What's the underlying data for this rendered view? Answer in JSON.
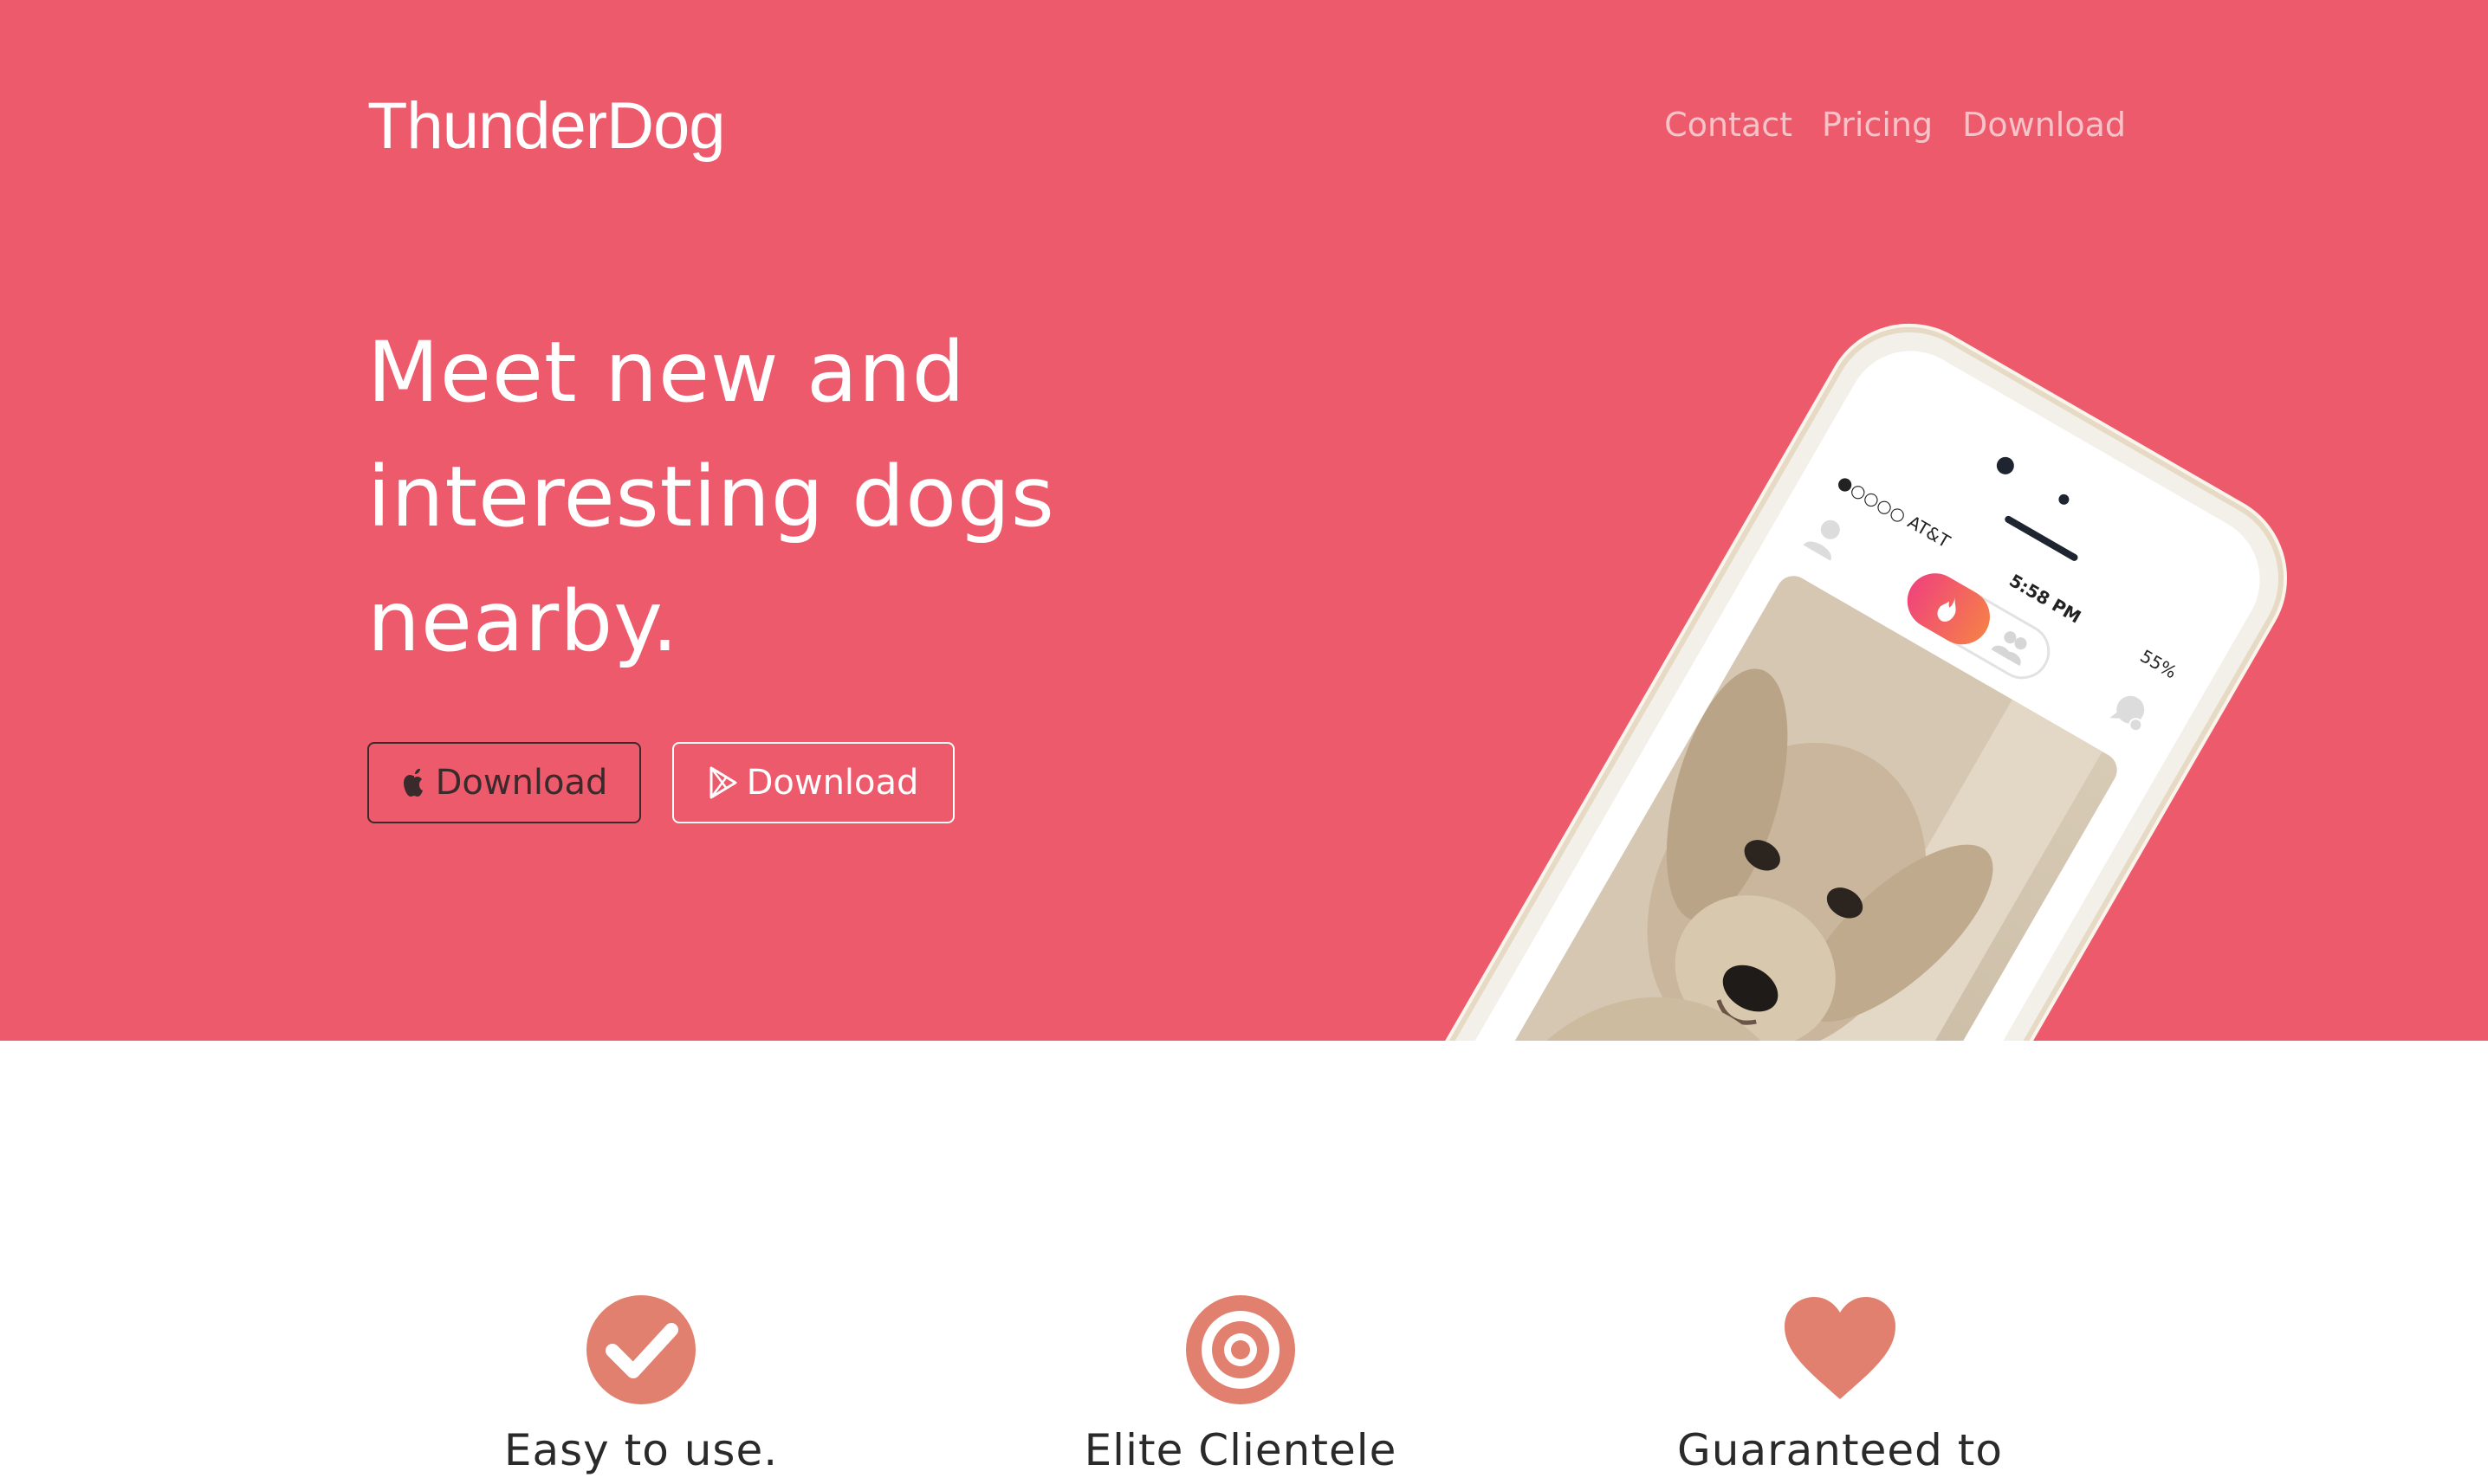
{
  "brand": {
    "name": "ThunderDog"
  },
  "nav": {
    "items": [
      "Contact",
      "Pricing",
      "Download"
    ]
  },
  "hero": {
    "headline_lines": [
      "Meet new and",
      "interesting dogs",
      "nearby."
    ],
    "apple_button_label": "Download",
    "play_button_label": "Download",
    "background_color": "#ec5a6c"
  },
  "phone": {
    "carrier": "●○○○○ AT&T",
    "time": "5:58 PM",
    "battery": "55%"
  },
  "features": [
    {
      "icon": "check-circle-icon",
      "label": "Easy to use."
    },
    {
      "icon": "target-icon",
      "label": "Elite Clientele"
    },
    {
      "icon": "heart-icon",
      "label": "Guaranteed to"
    }
  ],
  "colors": {
    "accent": "#e1806f",
    "hero_bg": "#ec5a6c"
  }
}
